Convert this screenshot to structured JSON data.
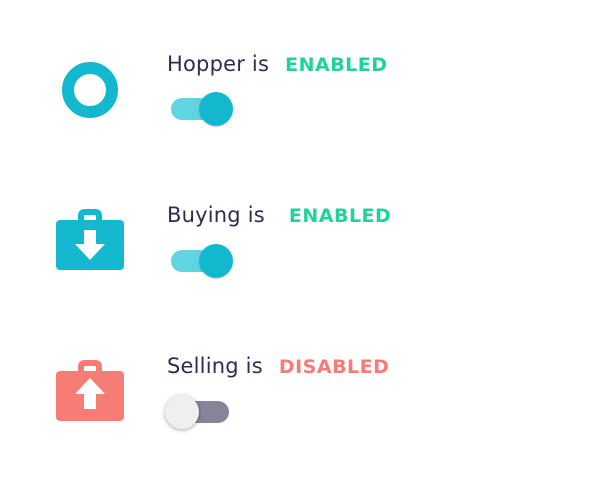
{
  "colors": {
    "accent": "#13b8cf",
    "enabled": "#20d39b",
    "disabled": "#f67c75",
    "label": "#2b2d52"
  },
  "settings": [
    {
      "icon": "hopper-ring-icon",
      "label": "Hopper is",
      "state": "ENABLED",
      "enabled": true
    },
    {
      "icon": "buy-briefcase-down-arrow-icon",
      "label": "Buying is",
      "state": "ENABLED",
      "enabled": true
    },
    {
      "icon": "sell-briefcase-up-arrow-icon",
      "label": "Selling is",
      "state": "DISABLED",
      "enabled": false
    }
  ]
}
